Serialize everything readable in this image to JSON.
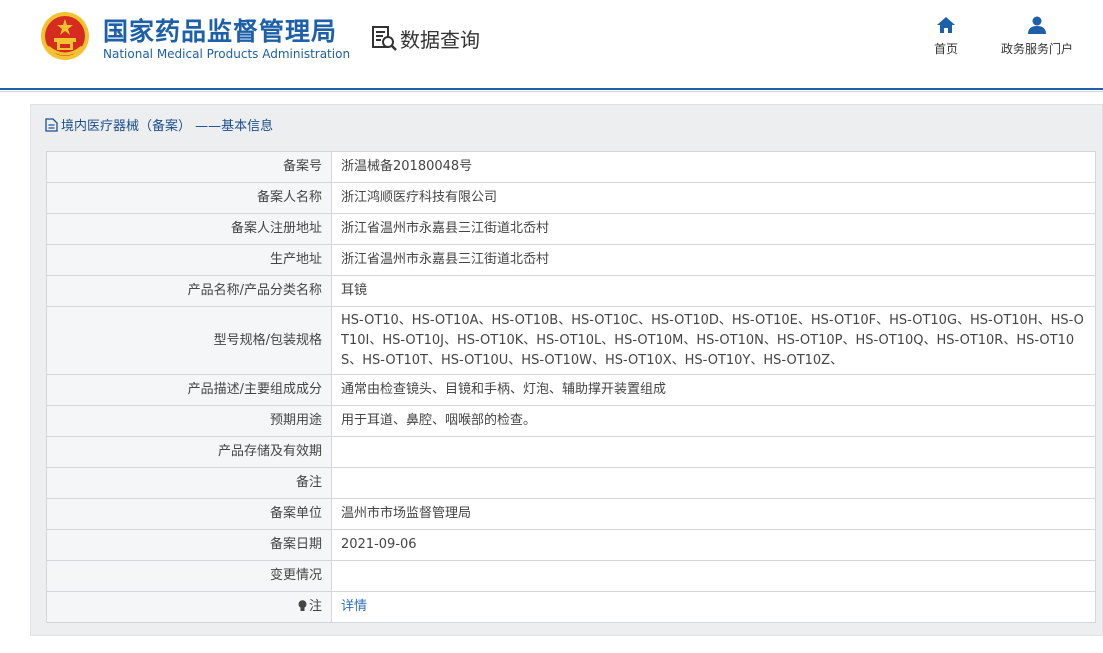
{
  "header": {
    "org_cn": "国家药品监督管理局",
    "org_en": "National Medical Products Administration",
    "section_title": "数据查询",
    "nav": [
      {
        "label": "首页",
        "icon": "home-icon"
      },
      {
        "label": "政务服务门户",
        "icon": "user-icon"
      }
    ]
  },
  "panel": {
    "title": "境内医疗器械（备案） ——基本信息"
  },
  "rows": [
    {
      "label": "备案号",
      "value": "浙温械备20180048号"
    },
    {
      "label": "备案人名称",
      "value": "浙江鸿顺医疗科技有限公司"
    },
    {
      "label": "备案人注册地址",
      "value": "浙江省温州市永嘉县三江街道北岙村"
    },
    {
      "label": "生产地址",
      "value": "浙江省温州市永嘉县三江街道北岙村"
    },
    {
      "label": "产品名称/产品分类名称",
      "value": "耳镜"
    },
    {
      "label": "型号规格/包装规格",
      "value": "HS-OT10、HS-OT10A、HS-OT10B、HS-OT10C、HS-OT10D、HS-OT10E、HS-OT10F、HS-OT10G、HS-OT10H、HS-OT10I、HS-OT10J、HS-OT10K、HS-OT10L、HS-OT10M、HS-OT10N、HS-OT10P、HS-OT10Q、HS-OT10R、HS-OT10S、HS-OT10T、HS-OT10U、HS-OT10W、HS-OT10X、HS-OT10Y、HS-OT10Z、"
    },
    {
      "label": "产品描述/主要组成成分",
      "value": "通常由检查镜头、目镜和手柄、灯泡、辅助撑开装置组成"
    },
    {
      "label": "预期用途",
      "value": "用于耳道、鼻腔、咽喉部的检查。"
    },
    {
      "label": "产品存储及有效期",
      "value": ""
    },
    {
      "label": "备注",
      "value": ""
    },
    {
      "label": "备案单位",
      "value": "温州市市场监督管理局"
    },
    {
      "label": "备案日期",
      "value": "2021-09-06"
    },
    {
      "label": "变更情况",
      "value": ""
    }
  ],
  "note": {
    "label": "注",
    "link": "详情"
  },
  "colors": {
    "brand_blue": "#1d5fa8",
    "link_blue": "#2f6fc0",
    "emblem_red": "#d62b1f",
    "emblem_gold": "#f2c230"
  }
}
